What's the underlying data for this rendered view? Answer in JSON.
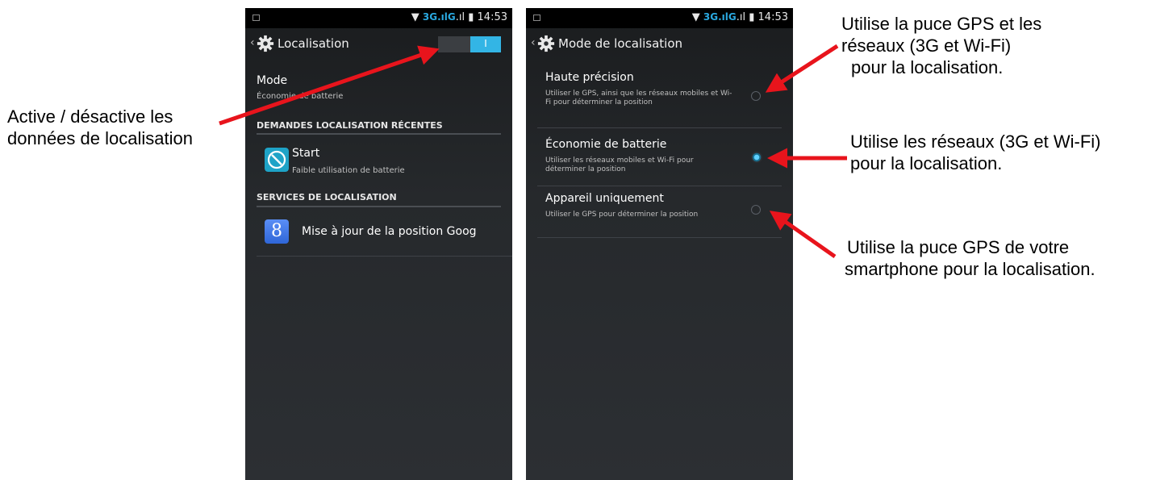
{
  "annotations": {
    "left": [
      "Active / désactive les",
      "données de localisation"
    ],
    "right_top": [
      "Utilise la puce GPS et les",
      "réseaux (3G et Wi-Fi)",
      "pour la localisation."
    ],
    "right_mid": [
      "Utilise les réseaux (3G et Wi-Fi)",
      "pour la localisation."
    ],
    "right_bottom": [
      "Utilise la puce GPS de votre",
      "smartphone pour la localisation."
    ]
  },
  "status_bar": {
    "network": "3G",
    "signal2": "G",
    "time": "14:53"
  },
  "screen1": {
    "title": "Localisation",
    "toggle_label": "I",
    "mode": {
      "title": "Mode",
      "subtitle": "Économie de batterie"
    },
    "section_recent": "DEMANDES LOCALISATION RÉCENTES",
    "recent_app": {
      "name": "Start",
      "detail": "Faible utilisation de batterie",
      "icon": "start-app-icon"
    },
    "section_services": "SERVICES DE LOCALISATION",
    "service": {
      "name": "Mise à jour de la position Goog",
      "icon": "google-icon",
      "icon_letter": "8"
    }
  },
  "screen2": {
    "title": "Mode de localisation",
    "options": [
      {
        "title": "Haute précision",
        "description": "Utiliser le GPS, ainsi que les réseaux mobiles et Wi-Fi pour déterminer la position",
        "selected": false
      },
      {
        "title": "Économie de batterie",
        "description": "Utiliser les réseaux mobiles et Wi-Fi pour déterminer la position",
        "selected": true
      },
      {
        "title": "Appareil uniquement",
        "description": "Utiliser le GPS pour déterminer la position",
        "selected": false
      }
    ]
  },
  "colors": {
    "accent": "#33b5e5",
    "arrow": "#e8141c",
    "screen_bg": "#26292c"
  }
}
